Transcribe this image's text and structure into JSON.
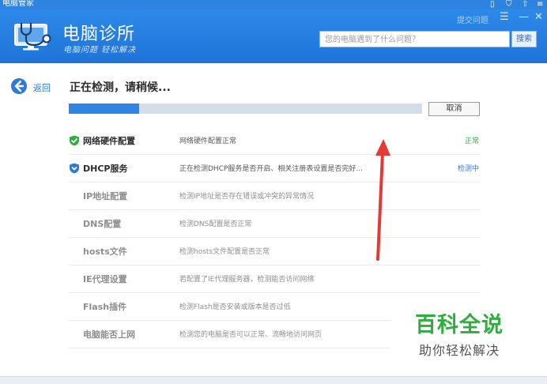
{
  "window": {
    "app_name": "电脑管家",
    "sys_icons": [
      "device-icon",
      "shield-icon",
      "upload-icon",
      "menu-icon"
    ]
  },
  "header": {
    "title": "电脑诊所",
    "slogan": "电脑问题 轻松解决",
    "feedback_link": "提交问题",
    "search_placeholder": "您的电脑遇到了什么问题？",
    "search_button": "搜索",
    "controls": [
      "menu",
      "minimize",
      "close"
    ]
  },
  "nav": {
    "back_label": "返回"
  },
  "scan": {
    "status_title": "正在检测，请稍候...",
    "progress": 0.2,
    "cancel_label": "取消"
  },
  "checks": [
    {
      "name": "网络硬件配置",
      "desc": "网络硬件配置正常",
      "status": "正常",
      "state": "done",
      "icon": "check-shield-icon"
    },
    {
      "name": "DHCP服务",
      "desc": "正在检测DHCP服务是否开启、相关注册表设置是否完好...",
      "status": "检测中",
      "state": "active",
      "icon": "pending-shield-icon"
    },
    {
      "name": "IP地址配置",
      "desc": "检测IP地址是否存在错误或冲突的异常情况",
      "status": "",
      "state": "pending"
    },
    {
      "name": "DNS配置",
      "desc": "检测DNS配置是否正常",
      "status": "",
      "state": "pending"
    },
    {
      "name": "hosts文件",
      "desc": "检测hosts文件配置是否正常",
      "status": "",
      "state": "pending"
    },
    {
      "name": "IE代理设置",
      "desc": "若配置了IE代理服务器，检测能否访问网络",
      "status": "",
      "state": "pending"
    },
    {
      "name": "Flash插件",
      "desc": "检测Flash是否安装或版本是否过低",
      "status": "",
      "state": "pending"
    },
    {
      "name": "电脑能否上网",
      "desc": "检测您的电脑是否可以正常、流畅地访问网页",
      "status": "",
      "state": "pending"
    }
  ],
  "watermark": {
    "title": "百科全说",
    "subtitle": "助你轻松解决"
  },
  "colors": {
    "header": "#2380df",
    "accent": "#2e86e2",
    "ok": "#2fae3e",
    "checking": "#2f7ad6",
    "annotation_arrow": "#e53935"
  }
}
